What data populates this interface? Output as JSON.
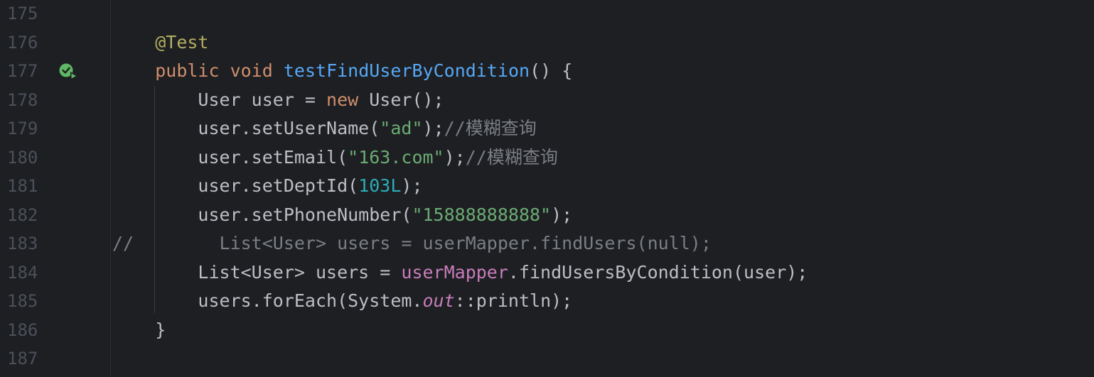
{
  "editor": {
    "lines": [
      {
        "number": "175",
        "tokens": []
      },
      {
        "number": "176",
        "tokens": [
          {
            "t": "    ",
            "c": "plain"
          },
          {
            "t": "@Test",
            "c": "ann"
          }
        ]
      },
      {
        "number": "177",
        "run_icon": "run-test-passed-icon",
        "tokens": [
          {
            "t": "    ",
            "c": "plain"
          },
          {
            "t": "public",
            "c": "kw"
          },
          {
            "t": " ",
            "c": "plain"
          },
          {
            "t": "void",
            "c": "kw"
          },
          {
            "t": " ",
            "c": "plain"
          },
          {
            "t": "testFindUserByCondition",
            "c": "fn-decl"
          },
          {
            "t": "() {",
            "c": "plain"
          }
        ]
      },
      {
        "number": "178",
        "tokens": [
          {
            "t": "        User user = ",
            "c": "plain"
          },
          {
            "t": "new",
            "c": "kw"
          },
          {
            "t": " User();",
            "c": "plain"
          }
        ]
      },
      {
        "number": "179",
        "tokens": [
          {
            "t": "        user.setUserName(",
            "c": "plain"
          },
          {
            "t": "\"ad\"",
            "c": "str"
          },
          {
            "t": ");",
            "c": "plain"
          },
          {
            "t": "//模糊查询",
            "c": "cmt"
          }
        ]
      },
      {
        "number": "180",
        "tokens": [
          {
            "t": "        user.setEmail(",
            "c": "plain"
          },
          {
            "t": "\"163.com\"",
            "c": "str"
          },
          {
            "t": ");",
            "c": "plain"
          },
          {
            "t": "//模糊查询",
            "c": "cmt"
          }
        ]
      },
      {
        "number": "181",
        "tokens": [
          {
            "t": "        user.setDeptId(",
            "c": "plain"
          },
          {
            "t": "103L",
            "c": "num"
          },
          {
            "t": ");",
            "c": "plain"
          }
        ]
      },
      {
        "number": "182",
        "tokens": [
          {
            "t": "        user.setPhoneNumber(",
            "c": "plain"
          },
          {
            "t": "\"15888888888\"",
            "c": "str"
          },
          {
            "t": ");",
            "c": "plain"
          }
        ]
      },
      {
        "number": "183",
        "tokens": [
          {
            "t": "//        List<User> users = userMapper.findUsers(null);",
            "c": "cmt"
          }
        ]
      },
      {
        "number": "184",
        "tokens": [
          {
            "t": "        List<User> users = ",
            "c": "plain"
          },
          {
            "t": "userMapper",
            "c": "field"
          },
          {
            "t": ".findUsersByCondition(user);",
            "c": "plain"
          }
        ]
      },
      {
        "number": "185",
        "tokens": [
          {
            "t": "        users.forEach(System.",
            "c": "plain"
          },
          {
            "t": "out",
            "c": "static-field"
          },
          {
            "t": "::println);",
            "c": "plain"
          }
        ]
      },
      {
        "number": "186",
        "tokens": [
          {
            "t": "    }",
            "c": "plain"
          }
        ]
      },
      {
        "number": "187",
        "tokens": []
      }
    ]
  },
  "colors": {
    "background": "#1e1f22",
    "keyword": "#cf8e6d",
    "annotation": "#b3ae60",
    "function_declaration": "#56a8f5",
    "string": "#6aab73",
    "number": "#2aacb8",
    "comment": "#7a7e85",
    "field": "#c77dbb",
    "line_number": "#4b5059"
  }
}
